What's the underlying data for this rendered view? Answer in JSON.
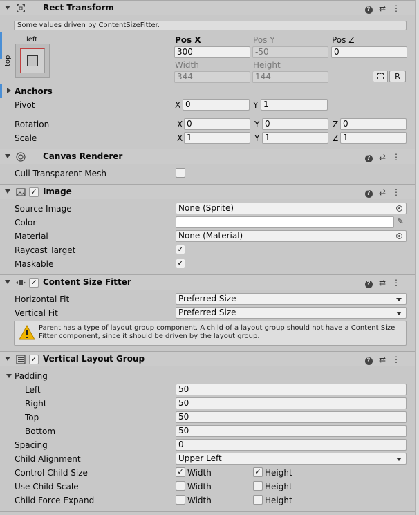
{
  "rect_transform": {
    "title": "Rect Transform",
    "info_note": "Some values driven by ContentSizeFitter.",
    "anchor_preset": {
      "h_label": "left",
      "v_label": "top"
    },
    "pos_x": {
      "label": "Pos X",
      "value": "300"
    },
    "pos_y": {
      "label": "Pos Y",
      "value": "-50"
    },
    "pos_z": {
      "label": "Pos Z",
      "value": "0"
    },
    "width": {
      "label": "Width",
      "value": "344"
    },
    "height": {
      "label": "Height",
      "value": "144"
    },
    "raw_edit_button": "R",
    "anchors_label": "Anchors",
    "pivot": {
      "label": "Pivot",
      "x": "0",
      "y": "1"
    },
    "rotation": {
      "label": "Rotation",
      "x": "0",
      "y": "0",
      "z": "0"
    },
    "scale": {
      "label": "Scale",
      "x": "1",
      "y": "1",
      "z": "1"
    },
    "axis_labels": {
      "x": "X",
      "y": "Y",
      "z": "Z"
    }
  },
  "canvas_renderer": {
    "title": "Canvas Renderer",
    "cull_label": "Cull Transparent Mesh",
    "cull_checked": false
  },
  "image": {
    "title": "Image",
    "enabled": true,
    "source_image": {
      "label": "Source Image",
      "value": "None (Sprite)"
    },
    "color": {
      "label": "Color",
      "value": "#ffffff"
    },
    "material": {
      "label": "Material",
      "value": "None (Material)"
    },
    "raycast": {
      "label": "Raycast Target",
      "checked": true
    },
    "maskable": {
      "label": "Maskable",
      "checked": true
    }
  },
  "content_size_fitter": {
    "title": "Content Size Fitter",
    "enabled": true,
    "horizontal": {
      "label": "Horizontal Fit",
      "value": "Preferred Size"
    },
    "vertical": {
      "label": "Vertical Fit",
      "value": "Preferred Size"
    },
    "warning": "Parent has a type of layout group component. A child of a layout group should not have a Content Size Fitter component, since it should be driven by the layout group."
  },
  "vertical_layout_group": {
    "title": "Vertical Layout Group",
    "enabled": true,
    "padding": {
      "label": "Padding",
      "left": {
        "label": "Left",
        "value": "50"
      },
      "right": {
        "label": "Right",
        "value": "50"
      },
      "top": {
        "label": "Top",
        "value": "50"
      },
      "bottom": {
        "label": "Bottom",
        "value": "50"
      }
    },
    "spacing": {
      "label": "Spacing",
      "value": "0"
    },
    "child_alignment": {
      "label": "Child Alignment",
      "value": "Upper Left"
    },
    "control_child_size": {
      "label": "Control Child Size",
      "width": true,
      "height": true
    },
    "use_child_scale": {
      "label": "Use Child Scale",
      "width": false,
      "height": false
    },
    "child_force_expand": {
      "label": "Child Force Expand",
      "width": false,
      "height": false
    },
    "width_label": "Width",
    "height_label": "Height"
  },
  "header_icons": {
    "help": "?",
    "settings": "⇄",
    "menu": "⋮"
  },
  "checkmark": "✓",
  "colors": {
    "background": "#c8c8c8",
    "field": "#f0f0f0",
    "disabled_field": "#d3d3d3",
    "selection_bar": "#4a8fd6",
    "warning_icon": "#f0b400"
  }
}
